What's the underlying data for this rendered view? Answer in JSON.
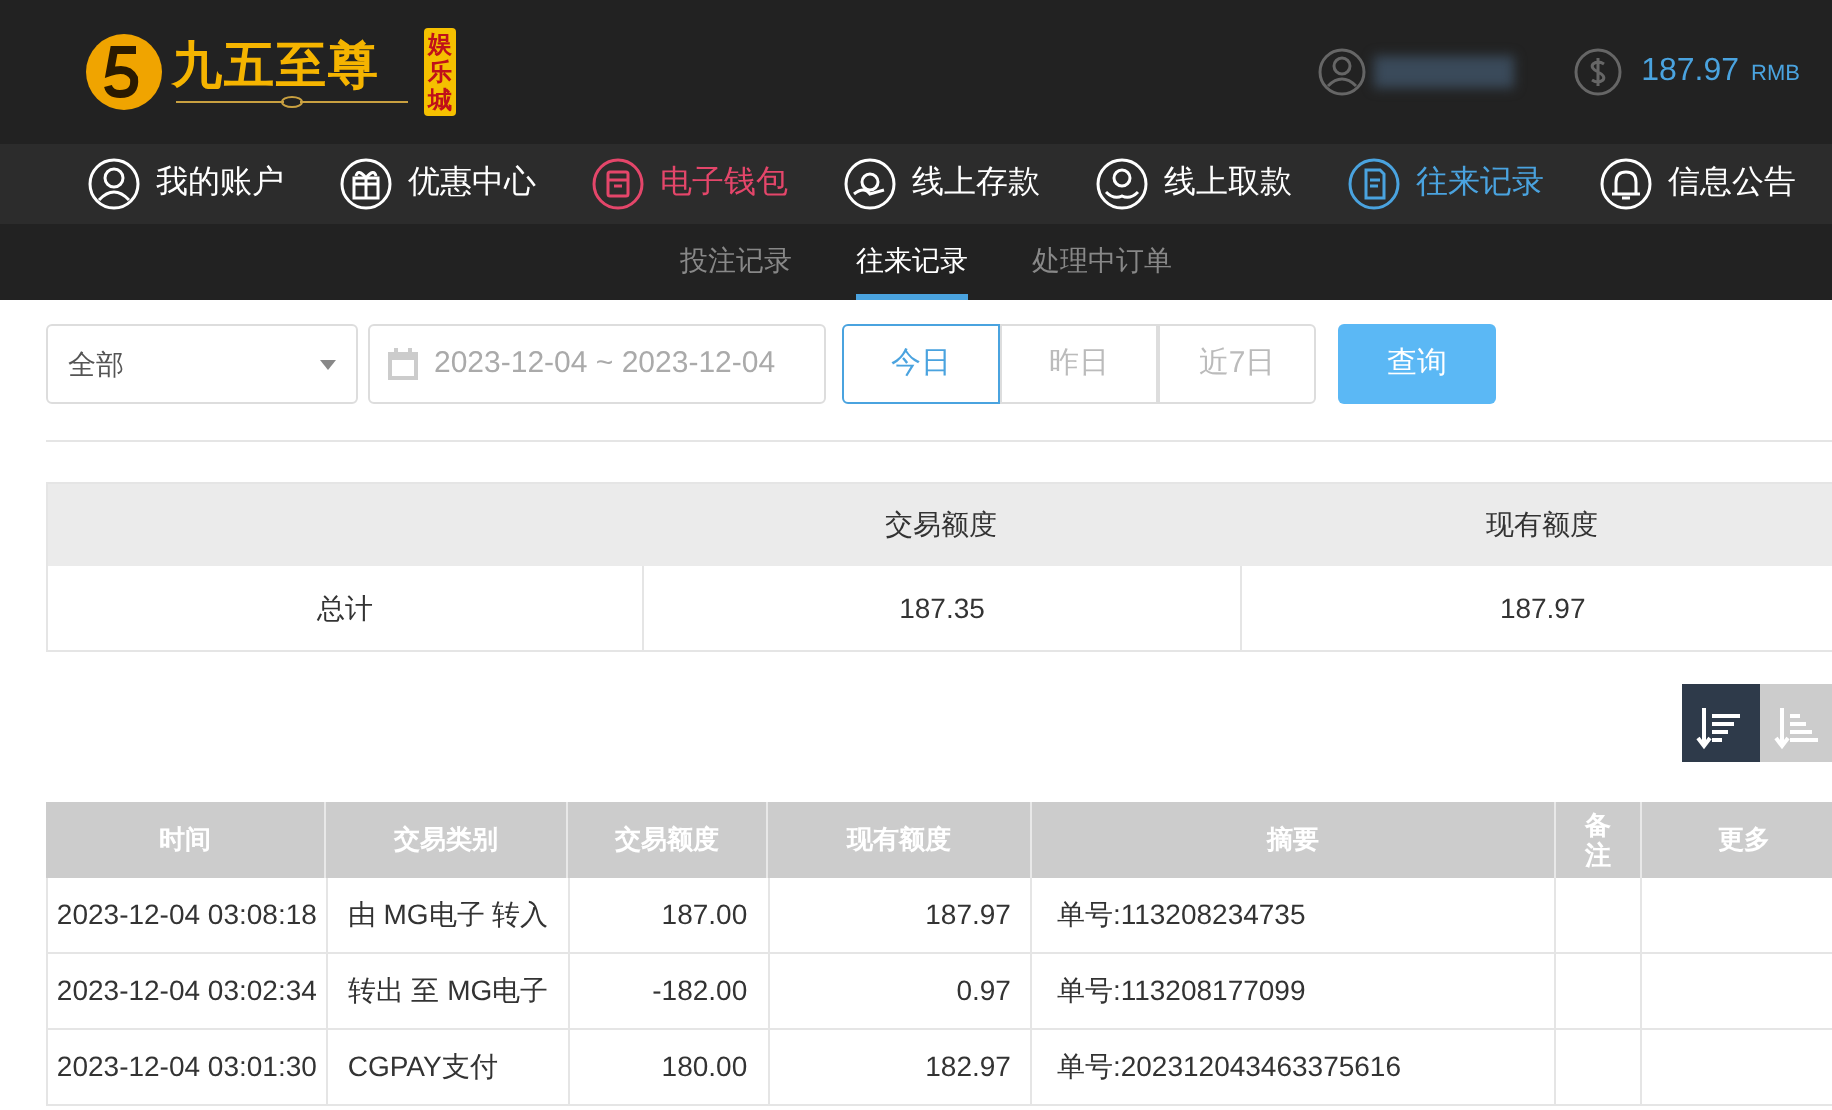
{
  "header": {
    "logo_title": "九五至尊",
    "logo_badge": "娱乐城",
    "balance": "187.97",
    "currency": "RMB"
  },
  "nav": [
    {
      "label": "我的账户",
      "selected": false,
      "highlighted": false
    },
    {
      "label": "优惠中心",
      "selected": false,
      "highlighted": false
    },
    {
      "label": "电子钱包",
      "selected": false,
      "highlighted": true
    },
    {
      "label": "线上存款",
      "selected": false,
      "highlighted": false
    },
    {
      "label": "线上取款",
      "selected": false,
      "highlighted": false
    },
    {
      "label": "往来记录",
      "selected": true,
      "highlighted": false
    },
    {
      "label": "信息公告",
      "selected": false,
      "highlighted": false
    }
  ],
  "sub_tabs": [
    {
      "label": "投注记录",
      "selected": false
    },
    {
      "label": "往来记录",
      "selected": true
    },
    {
      "label": "处理中订单",
      "selected": false
    }
  ],
  "filters": {
    "type_select": "全部",
    "date_range": "2023-12-04 ~ 2023-12-04",
    "quick_ranges": [
      {
        "label": "今日",
        "selected": true
      },
      {
        "label": "昨日",
        "selected": false
      },
      {
        "label": "近7日",
        "selected": false
      }
    ],
    "query_button": "查询"
  },
  "summary": {
    "columns": [
      "",
      "交易额度",
      "现有额度"
    ],
    "row": [
      "总计",
      "187.35",
      "187.97"
    ]
  },
  "sort_buttons": [
    {
      "selected": true
    },
    {
      "selected": false
    }
  ],
  "table": {
    "columns": [
      "时间",
      "交易类别",
      "交易额度",
      "现有额度",
      "摘要",
      "备注",
      "更多"
    ],
    "rows": [
      [
        "2023-12-04 03:08:18",
        "由 MG电子 转入",
        "187.00",
        "187.97",
        "单号:113208234735",
        "",
        ""
      ],
      [
        "2023-12-04 03:02:34",
        "转出 至 MG电子",
        "-182.00",
        "0.97",
        "单号:113208177099",
        "",
        ""
      ],
      [
        "2023-12-04 03:01:30",
        "CGPAY支付",
        "180.00",
        "182.97",
        "单号:20231204346337561​6",
        "",
        ""
      ]
    ]
  }
}
